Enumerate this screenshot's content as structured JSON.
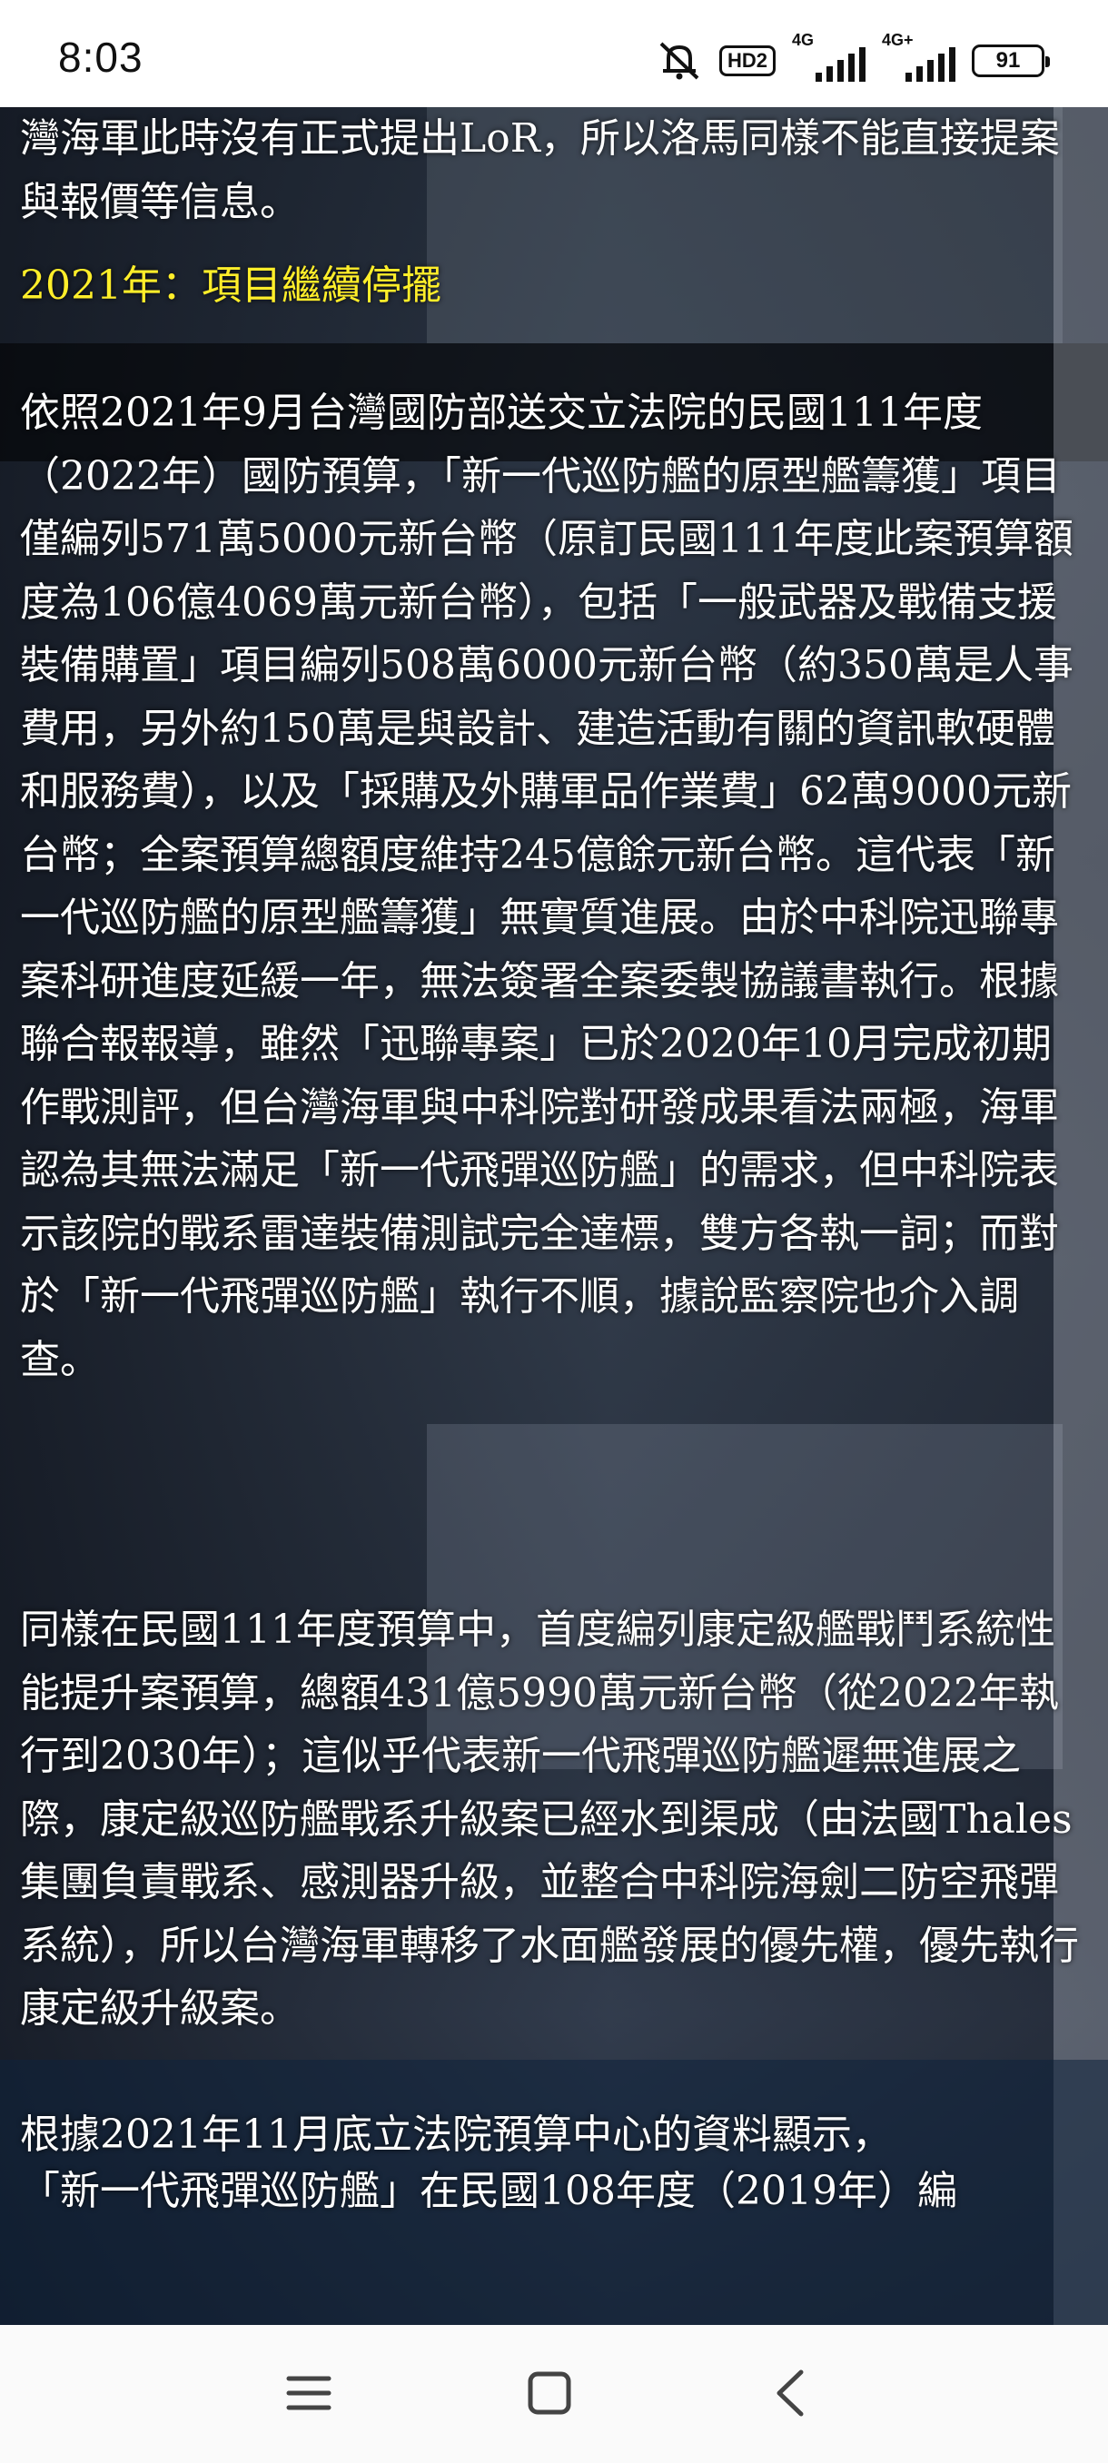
{
  "status_bar": {
    "time": "8:03",
    "hd_label": "HD2",
    "sim1_label": "4G",
    "sim2_label": "4G+",
    "battery": "91"
  },
  "article": {
    "intro": "灣海軍此時沒有正式提出LoR，所以洛馬同樣不能直接提案與報價等信息。",
    "heading": "2021年：項目繼續停擺",
    "paragraph_1": "依照2021年9月台灣國防部送交立法院的民國111年度（2022年）國防預算，「新一代巡防艦的原型艦籌獲」項目僅編列571萬5000元新台幣（原訂民國111年度此案預算額度為106億4069萬元新台幣），包括「一般武器及戰備支援裝備購置」項目編列508萬6000元新台幣（約350萬是人事費用，另外約150萬是與設計、建造活動有關的資訊軟硬體和服務費），以及「採購及外購軍品作業費」62萬9000元新台幣；全案預算總額度維持245億餘元新台幣。這代表「新一代巡防艦的原型艦籌獲」無實質進展。由於中科院迅聯專案科研進度延緩一年，無法簽署全案委製協議書執行。根據聯合報報導，雖然「迅聯專案」已於2020年10月完成初期作戰測評，但台灣海軍與中科院對研發成果看法兩極，海軍認為其無法滿足「新一代飛彈巡防艦」的需求，但中科院表示該院的戰系雷達裝備測試完全達標，雙方各執一詞；而對於「新一代飛彈巡防艦」執行不順，據說監察院也介入調查。",
    "paragraph_2": "同樣在民國111年度預算中，首度編列康定級艦戰鬥系統性能提升案預算，總額431億5990萬元新台幣（從2022年執行到2030年）；這似乎代表新一代飛彈巡防艦遲無進展之際，康定級巡防艦戰系升級案已經水到渠成（由法國Thales集團負責戰系、感測器升級，並整合中科院海劍二防空飛彈系統），所以台灣海軍轉移了水面艦發展的優先權，優先執行康定級升級案。",
    "paragraph_3": "根據2021年11月底立法院預算中心的資料顯示，",
    "paragraph_4": "「新一代飛彈巡防艦」在民國108年度（2019年）編"
  }
}
